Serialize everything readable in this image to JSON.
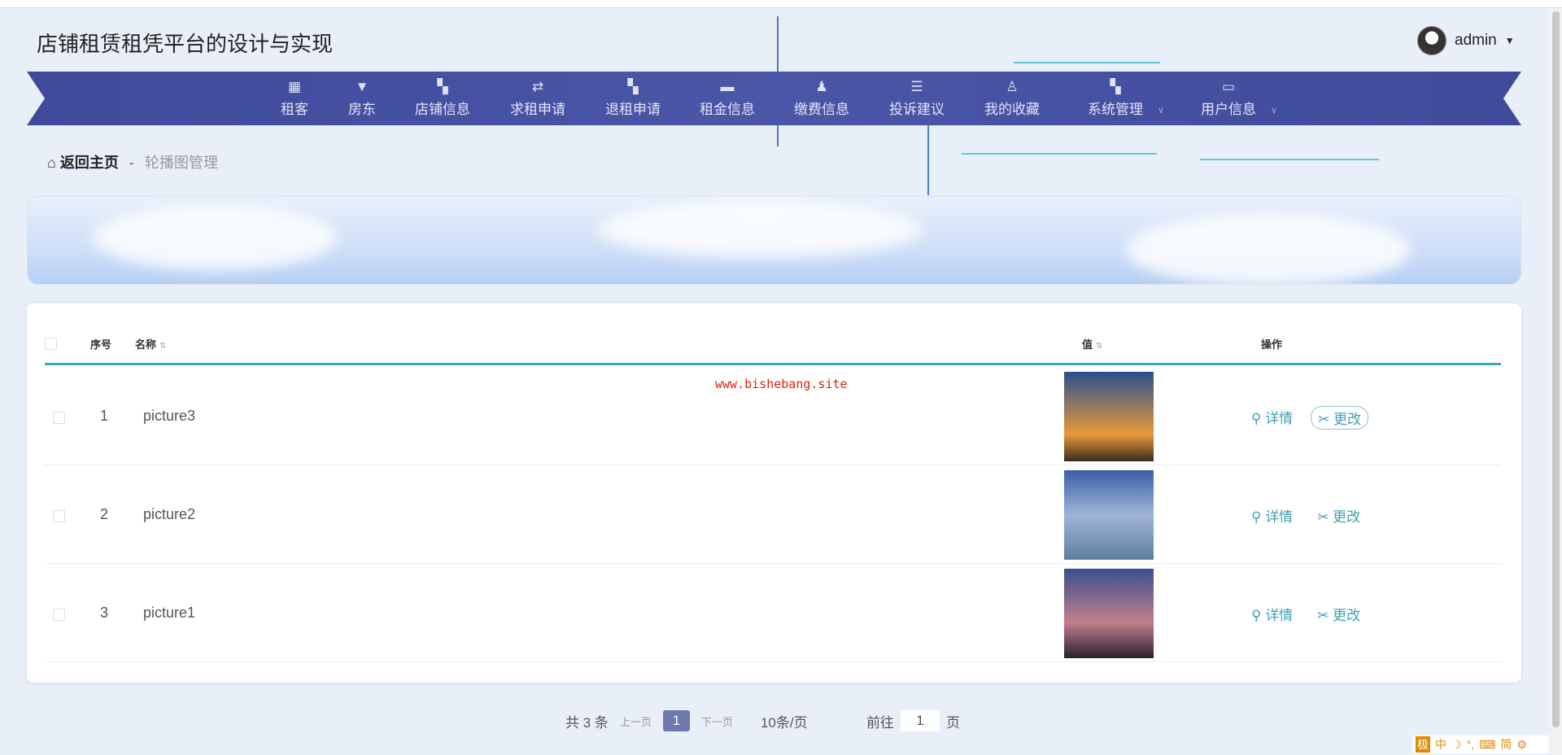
{
  "app": {
    "title": "店铺租赁租凭平台的设计与实现",
    "user": "admin"
  },
  "nav": [
    {
      "label": "租客",
      "icon": "grid-icon"
    },
    {
      "label": "房东",
      "icon": "brush-icon"
    },
    {
      "label": "店铺信息",
      "icon": "apps-icon"
    },
    {
      "label": "求租申请",
      "icon": "sliders-icon"
    },
    {
      "label": "退租申请",
      "icon": "apps-icon"
    },
    {
      "label": "租金信息",
      "icon": "cup-icon"
    },
    {
      "label": "缴费信息",
      "icon": "stamp-icon"
    },
    {
      "label": "投诉建议",
      "icon": "list-icon"
    },
    {
      "label": "我的收藏",
      "icon": "user-icon"
    },
    {
      "label": "系统管理",
      "icon": "apps-icon"
    },
    {
      "label": "用户信息",
      "icon": "wallet-icon"
    }
  ],
  "breadcrumb": {
    "home": "返回主页",
    "sep": "-",
    "current": "轮播图管理"
  },
  "table": {
    "headers": {
      "index": "序号",
      "name": "名称",
      "value": "值",
      "actions": "操作"
    },
    "rows": [
      {
        "index": "1",
        "name": "picture3"
      },
      {
        "index": "2",
        "name": "picture2"
      },
      {
        "index": "3",
        "name": "picture1"
      }
    ],
    "detail": "详情",
    "edit": "更改"
  },
  "watermark": "www.bishebang.site",
  "pagination": {
    "total": "共 3 条",
    "prev": "上一页",
    "page": "1",
    "next": "下一页",
    "size": "10条/页",
    "goto": "前往",
    "goto_value": "1",
    "page_unit": "页"
  },
  "ime": {
    "logo": "极",
    "items": [
      "中",
      "☽",
      "°,",
      "⌨",
      "简",
      "⚙"
    ]
  }
}
